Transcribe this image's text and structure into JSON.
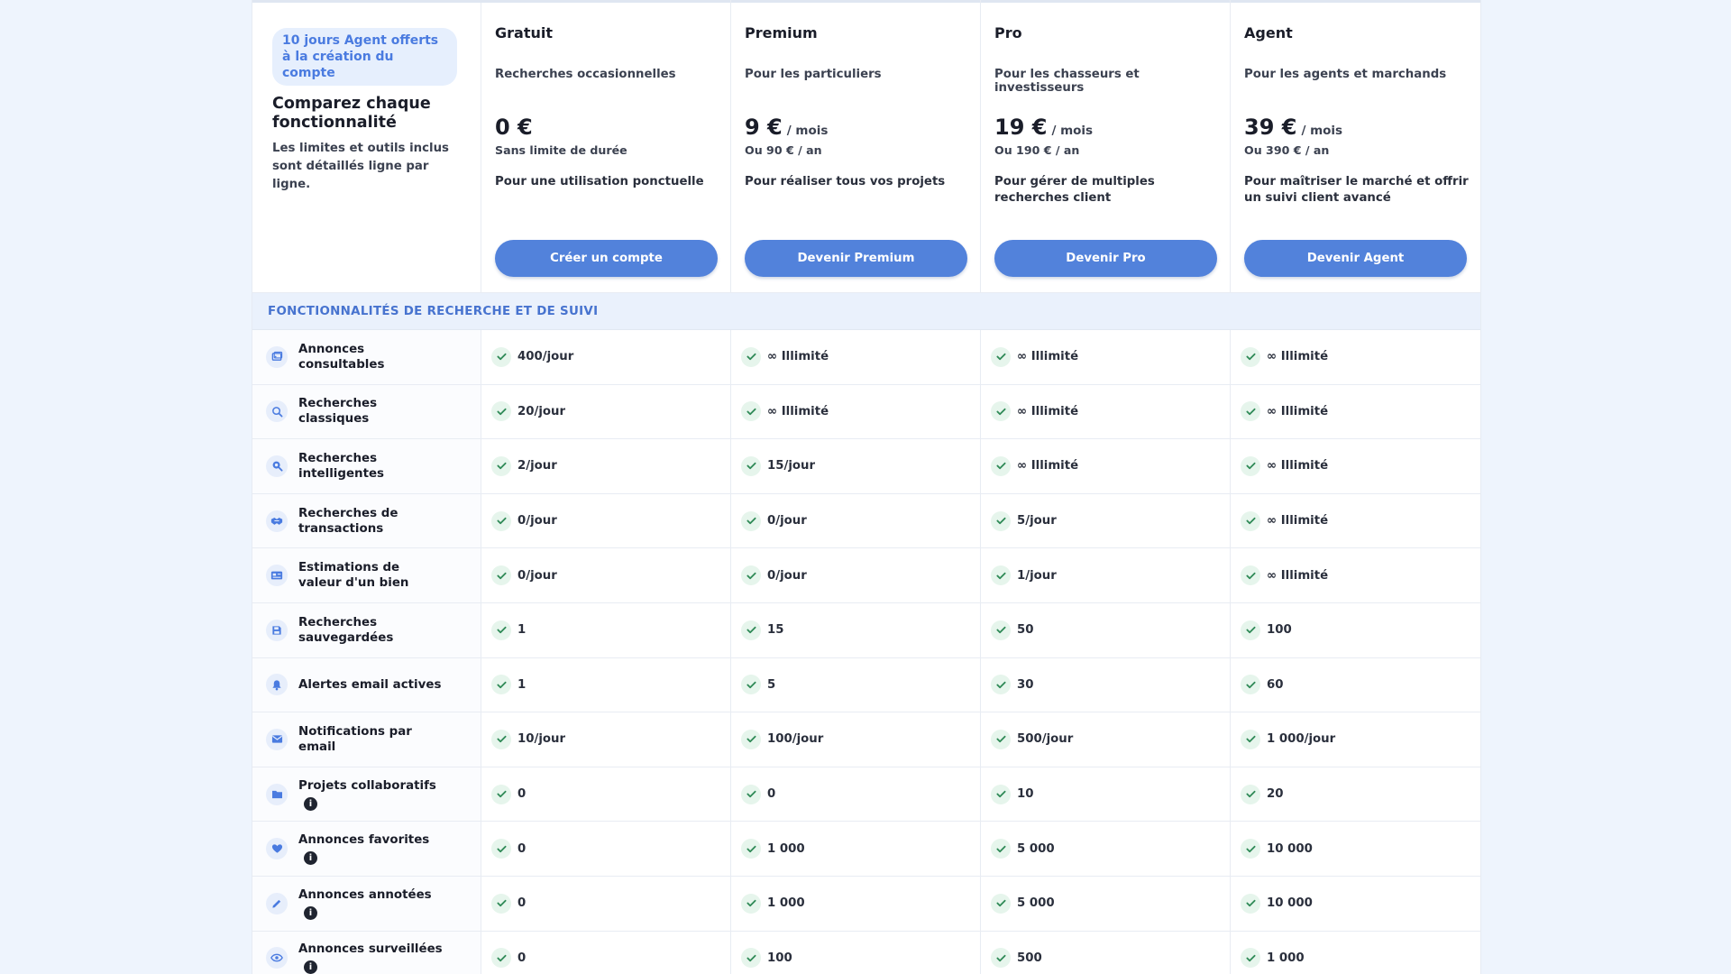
{
  "intro": {
    "promo": "10 jours Agent offerts à la création du compte",
    "title": "Comparez chaque fonctionnalité",
    "desc": "Les limites et outils inclus sont détaillés ligne par ligne."
  },
  "plans": [
    {
      "name": "Gratuit",
      "tag": "Recherches occasionnelles",
      "price": "0 €",
      "per": "",
      "sub": "Sans limite de durée",
      "note": "Pour une utilisation ponctuelle",
      "cta": "Créer un compte"
    },
    {
      "name": "Premium",
      "tag": "Pour les particuliers",
      "price": "9 €",
      "per": "/ mois",
      "sub": "Ou 90 € / an",
      "note": "Pour réaliser tous vos projets",
      "cta": "Devenir Premium"
    },
    {
      "name": "Pro",
      "tag": "Pour les chasseurs et investisseurs",
      "price": "19 €",
      "per": "/ mois",
      "sub": "Ou 190 € / an",
      "note": "Pour gérer de multiples recherches client",
      "cta": "Devenir Pro"
    },
    {
      "name": "Agent",
      "tag": "Pour les agents et marchands",
      "price": "39 €",
      "per": "/ mois",
      "sub": "Ou 390 € / an",
      "note": "Pour maîtriser le marché et offrir un suivi client avancé",
      "cta": "Devenir Agent"
    }
  ],
  "section_title": "FONCTIONNALITÉS DE RECHERCHE ET DE SUIVI",
  "colors": {
    "accent": "#5282db",
    "check_bg": "#e6f5ec",
    "check": "#2f8a57",
    "band": "#eaf1fc"
  },
  "features": [
    {
      "label": "Annonces consultables",
      "icon": "image-icon",
      "info": false,
      "values": [
        "400/jour",
        "∞ Illimité",
        "∞ Illimité",
        "∞ Illimité"
      ]
    },
    {
      "label": "Recherches classiques",
      "icon": "search-icon",
      "info": false,
      "values": [
        "20/jour",
        "∞ Illimité",
        "∞ Illimité",
        "∞ Illimité"
      ]
    },
    {
      "label": "Recherches intelligentes",
      "icon": "smart-search-icon",
      "info": false,
      "values": [
        "2/jour",
        "15/jour",
        "∞ Illimité",
        "∞ Illimité"
      ]
    },
    {
      "label": "Recherches de transactions",
      "icon": "handshake-icon",
      "info": false,
      "values": [
        "0/jour",
        "0/jour",
        "5/jour",
        "∞ Illimité"
      ]
    },
    {
      "label": "Estimations de valeur d'un bien",
      "icon": "card-icon",
      "info": false,
      "values": [
        "0/jour",
        "0/jour",
        "1/jour",
        "∞ Illimité"
      ]
    },
    {
      "label": "Recherches sauvegardées",
      "icon": "save-icon",
      "info": false,
      "values": [
        "1",
        "15",
        "50",
        "100"
      ]
    },
    {
      "label": "Alertes email actives",
      "icon": "bell-icon",
      "info": false,
      "values": [
        "1",
        "5",
        "30",
        "60"
      ]
    },
    {
      "label": "Notifications par email",
      "icon": "mail-icon",
      "info": false,
      "values": [
        "10/jour",
        "100/jour",
        "500/jour",
        "1 000/jour"
      ]
    },
    {
      "label": "Projets collaboratifs",
      "icon": "folder-icon",
      "info": true,
      "values": [
        "0",
        "0",
        "10",
        "20"
      ]
    },
    {
      "label": "Annonces favorites",
      "icon": "heart-icon",
      "info": true,
      "values": [
        "0",
        "1 000",
        "5 000",
        "10 000"
      ]
    },
    {
      "label": "Annonces annotées",
      "icon": "pencil-icon",
      "info": true,
      "values": [
        "0",
        "1 000",
        "5 000",
        "10 000"
      ]
    },
    {
      "label": "Annonces surveillées",
      "icon": "eye-icon",
      "info": true,
      "values": [
        "0",
        "100",
        "500",
        "1 000"
      ]
    }
  ]
}
